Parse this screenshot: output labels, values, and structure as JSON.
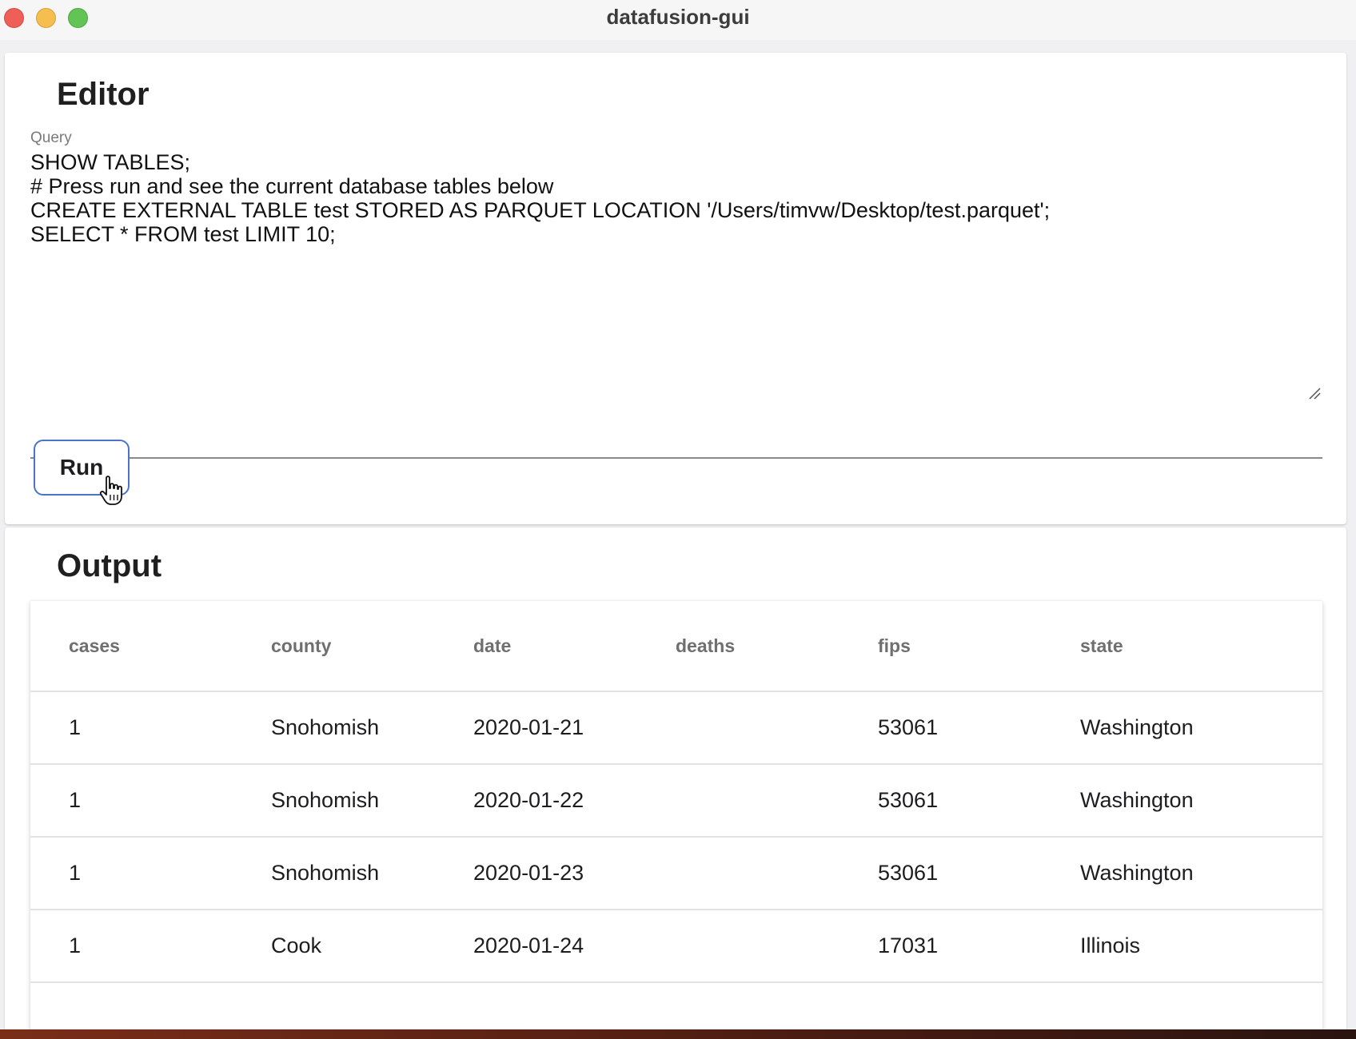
{
  "window": {
    "title": "datafusion-gui"
  },
  "editor": {
    "heading": "Editor",
    "query_label": "Query",
    "query_text": "SHOW TABLES;\n# Press run and see the current database tables below\nCREATE EXTERNAL TABLE test STORED AS PARQUET LOCATION '/Users/timvw/Desktop/test.parquet';\nSELECT * FROM test LIMIT 10;",
    "run_label": "Run"
  },
  "output": {
    "heading": "Output",
    "columns": [
      "cases",
      "county",
      "date",
      "deaths",
      "fips",
      "state"
    ],
    "rows": [
      [
        "1",
        "Snohomish",
        "2020-01-21",
        "",
        "53061",
        "Washington"
      ],
      [
        "1",
        "Snohomish",
        "2020-01-22",
        "",
        "53061",
        "Washington"
      ],
      [
        "1",
        "Snohomish",
        "2020-01-23",
        "",
        "53061",
        "Washington"
      ],
      [
        "1",
        "Cook",
        "2020-01-24",
        "",
        "17031",
        "Illinois"
      ]
    ]
  },
  "colors": {
    "close": "#ee5f57",
    "minimize": "#f5be4f",
    "maximize": "#61c454",
    "run_border": "#4a74c9"
  },
  "icons": [
    "close-icon",
    "minimize-icon",
    "maximize-icon",
    "resize-grip-icon",
    "hand-pointer-cursor-icon"
  ]
}
